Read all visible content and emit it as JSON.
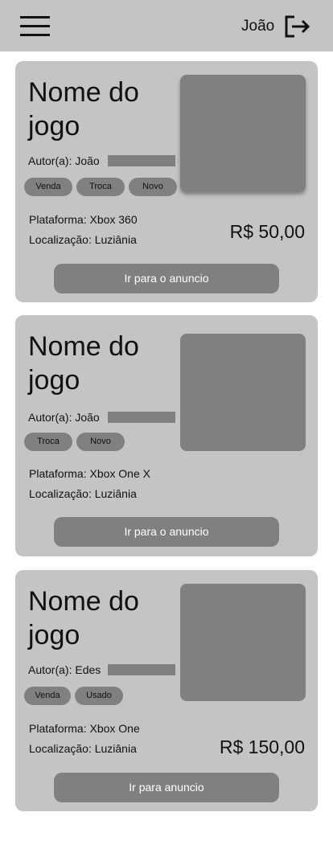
{
  "header": {
    "username": "João"
  },
  "cards": [
    {
      "title": "Nome do jogo",
      "author": "Autor(a): João",
      "tags": [
        "Venda",
        "Troca",
        "Novo"
      ],
      "platform": "Plataforma: Xbox 360",
      "location": "Localização: Luziânia",
      "price": "R$ 50,00",
      "button": "Ir para o anuncio"
    },
    {
      "title": "Nome do jogo",
      "author": "Autor(a): João",
      "tags": [
        "Troca",
        "Novo"
      ],
      "platform": "Plataforma: Xbox One X",
      "location": "Localização: Luziânia",
      "price": "",
      "button": "Ir para o anuncio"
    },
    {
      "title": "Nome do jogo",
      "author": "Autor(a): Edes",
      "tags": [
        "Venda",
        "Usado"
      ],
      "platform": "Plataforma: Xbox One",
      "location": "Localização: Luziânia",
      "price": "R$ 150,00",
      "button": "Ir para anuncio"
    }
  ]
}
